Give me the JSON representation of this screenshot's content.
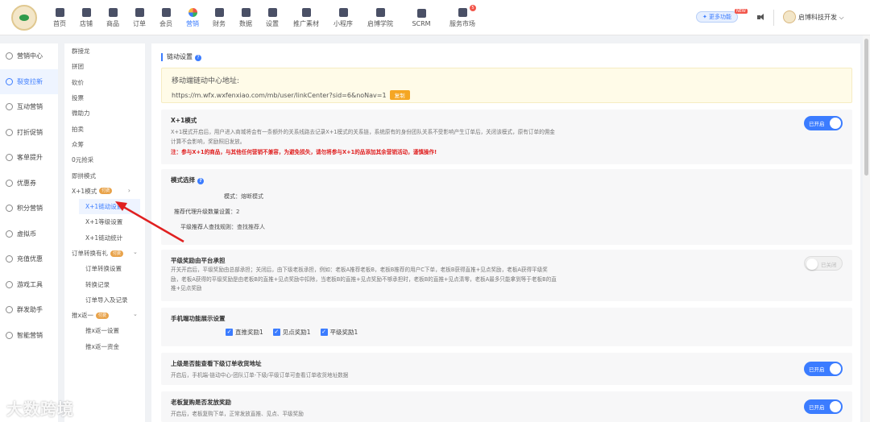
{
  "topnav": {
    "items": [
      {
        "label": "首页",
        "icon": "home-icon"
      },
      {
        "label": "店铺",
        "icon": "store-icon"
      },
      {
        "label": "商品",
        "icon": "goods-icon"
      },
      {
        "label": "订单",
        "icon": "order-icon"
      },
      {
        "label": "会员",
        "icon": "member-icon"
      },
      {
        "label": "营销",
        "icon": "marketing-icon"
      },
      {
        "label": "财务",
        "icon": "finance-icon"
      },
      {
        "label": "数据",
        "icon": "data-icon"
      },
      {
        "label": "设置",
        "icon": "settings-icon"
      },
      {
        "label": "推广素材",
        "icon": "share-icon"
      },
      {
        "label": "小程序",
        "icon": "miniprogram-icon"
      },
      {
        "label": "启博学院",
        "icon": "academy-icon"
      },
      {
        "label": "SCRM",
        "icon": "scrm-icon"
      },
      {
        "label": "服务市场",
        "icon": "market-icon"
      }
    ],
    "active": "营销",
    "more_label": "更多功能",
    "new_tag": "NEW",
    "market_badge": "5",
    "user_name": "启博科技开发"
  },
  "sidebar1": {
    "items": [
      "营销中心",
      "裂变拉新",
      "互动营销",
      "打折促销",
      "客单提升",
      "优惠券",
      "积分营销",
      "虚拟币",
      "充值优惠",
      "游戏工具",
      "群发助手",
      "智能营销"
    ],
    "active": "裂变拉新"
  },
  "sidebar2": {
    "items": [
      {
        "label": "群接龙"
      },
      {
        "label": "拼团"
      },
      {
        "label": "砍价"
      },
      {
        "label": "投票"
      },
      {
        "label": "微助力"
      },
      {
        "label": "拍卖"
      },
      {
        "label": "众筹"
      },
      {
        "label": "0元抢采"
      },
      {
        "label": "即拼模式"
      },
      {
        "label": "X+1模式",
        "tag": "付费"
      },
      {
        "label": "X+1链动设置",
        "sub": true
      },
      {
        "label": "X+1等级设置",
        "sub": true
      },
      {
        "label": "X+1链动统计",
        "sub": true
      },
      {
        "label": "订单转换有礼",
        "tag": "付费"
      },
      {
        "label": "订单转换设置",
        "sub": true
      },
      {
        "label": "转换记录",
        "sub": true
      },
      {
        "label": "订单导入及记录",
        "sub": true
      },
      {
        "label": "推x返一",
        "tag": "付费"
      },
      {
        "label": "推x返一设置",
        "sub": true
      },
      {
        "label": "推x返一资金",
        "sub": true
      }
    ],
    "active": "X+1链动设置"
  },
  "main": {
    "section_title": "链动设置",
    "notice_title": "移动端链动中心地址:",
    "notice_url": "https://m.wfx.wxfenxiao.com/mb/user/linkCenter?sid=6&noNav=1",
    "copy_label": "复制",
    "x1": {
      "title": "X+1模式",
      "desc": "X+1模式开启后，用户进入商城将会有一条额外的关系线路去记录X+1模式的关系链，系统原有的身份团队关系不受影响产生订单后，关闭该模式，原有订单的佣金计算不会影响，奖励照旧发放。",
      "warn": "注：参与X+1的商品，与其他任何营销不兼容，为避免损失，请勿将参与X+1的品添加其余营销活动，谨慎操作!",
      "toggle": "已开启"
    },
    "mode": {
      "title": "模式选择",
      "mode_label": "模式：",
      "mode_value": "熔断模式",
      "recommend_label": "推荐代理升级数量设置：",
      "recommend_value": "2",
      "rule_label": "平级推荐人查找规则：",
      "rule_value": "查找推荐人"
    },
    "flat": {
      "title": "平级奖励由平台承担",
      "desc": "开关开启后，平级奖励由总部承担；关闭后，由下级老板承担，例如：老板A推荐老板B，老板B推荐的用户C下单，老板B获得直推+见点奖励，老板A获得平级奖励，老板A获得的平级奖励是由老板B的直推+见点奖励中扣除，当老板B的直推+见点奖励不够承担时，老板B的直推+见点清零，老板A最多只能拿到等于老板B的直推+见点奖励",
      "toggle": "已关闭"
    },
    "mobile": {
      "title": "手机端功能展示设置",
      "options": [
        "直推奖励1",
        "见点奖励1",
        "平级奖励1"
      ]
    },
    "upper": {
      "title": "上级是否能查看下级订单收货地址",
      "desc": "开启后，手机端-链动中心-团队订单-下级/平级订单可查看订单收货地址数据",
      "toggle": "已开启"
    },
    "boss": {
      "title": "老板复购是否发放奖励",
      "desc": "开启后，老板复购下单，正常发放直推、见点、平级奖励",
      "toggle": "已开启"
    }
  },
  "watermark": "大数跨境",
  "colors": {
    "accent": "#3b7cff",
    "warning": "#e02020",
    "tag": "#e8a34b",
    "arrow": "#e02020"
  }
}
